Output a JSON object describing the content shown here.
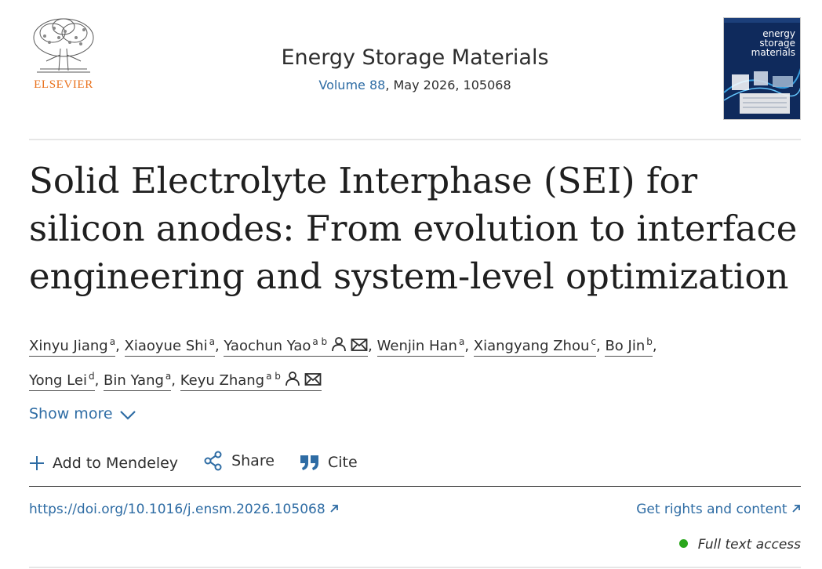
{
  "publisher": {
    "name": "ELSEVIER"
  },
  "journal": {
    "title": "Energy Storage Materials",
    "volume_link": "Volume 88",
    "issue_details": ", May 2026, 105068",
    "cover_text": "energy storage materials"
  },
  "article": {
    "title": "Solid Electrolyte Interphase (SEI) for silicon anodes: From evolution to interface engineering and system-level optimization"
  },
  "authors": [
    {
      "name": "Xinyu Jiang",
      "aff": "a",
      "icons": []
    },
    {
      "name": "Xiaoyue Shi",
      "aff": "a",
      "icons": []
    },
    {
      "name": "Yaochun Yao",
      "aff": "a b",
      "icons": [
        "person-icon",
        "mail-icon"
      ]
    },
    {
      "name": "Wenjin Han",
      "aff": "a",
      "icons": []
    },
    {
      "name": "Xiangyang Zhou",
      "aff": "c",
      "icons": []
    },
    {
      "name": "Bo Jin",
      "aff": "b",
      "icons": []
    },
    {
      "name": "Yong Lei",
      "aff": "d",
      "icons": []
    },
    {
      "name": "Bin Yang",
      "aff": "a",
      "icons": []
    },
    {
      "name": "Keyu Zhang",
      "aff": "a b",
      "icons": [
        "person-icon",
        "mail-icon"
      ]
    }
  ],
  "show_more": "Show more",
  "actions": {
    "mendeley": "Add to Mendeley",
    "share": "Share",
    "cite": "Cite"
  },
  "links": {
    "doi": "https://doi.org/10.1016/j.ensm.2026.105068",
    "rights": "Get rights and content"
  },
  "access": {
    "label": "Full text access",
    "status_color": "#29a61b"
  },
  "colors": {
    "accent": "#2e6ca4",
    "publisher_orange": "#e9711c"
  }
}
